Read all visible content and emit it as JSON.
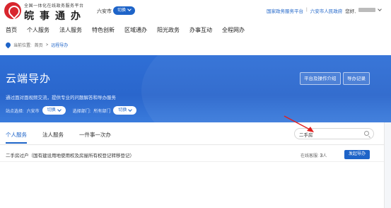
{
  "header": {
    "logo_small": "全国一体化在线政务服务平台",
    "logo_big": "皖事通办",
    "city": "六安市",
    "switch_label": "切换",
    "links": {
      "national": "国家政务服务平台",
      "municipal": "六安市人民政府",
      "greeting": "您好,"
    }
  },
  "nav": {
    "items": [
      "首页",
      "个人服务",
      "法人服务",
      "特色创新",
      "区域通办",
      "阳光政务",
      "办事互动",
      "全程网办"
    ]
  },
  "breadcrumb": {
    "label": "当前位置:",
    "home": "首页",
    "sep": ">",
    "current": "远程导办"
  },
  "hero": {
    "title": "云端导办",
    "desc": "通过面对面视频交流，提供专业的问题解答和导办服务",
    "site_label": "站点选择:",
    "site_value": "六安市",
    "site_switch": "切换",
    "dept_label": "选择部门:",
    "dept_value": "所有部门",
    "dept_switch": "切换",
    "btn_intro": "平台及操作介绍",
    "btn_record": "导办记录"
  },
  "panel": {
    "tabs": [
      "个人服务",
      "法人服务",
      "一件事一次办"
    ],
    "active_tab": 0,
    "search": {
      "value": "二手房"
    },
    "rows": [
      {
        "title": "二手房过户（国有建设用地使用权及房屋所有权登记转移登记）",
        "status_label": "在线客服:",
        "status_count": "3",
        "status_unit": "人",
        "action": "发起导办"
      }
    ]
  },
  "colors": {
    "brand": "#1e64c8",
    "logo_red": "#d8262e",
    "arrow": "#e02020"
  }
}
